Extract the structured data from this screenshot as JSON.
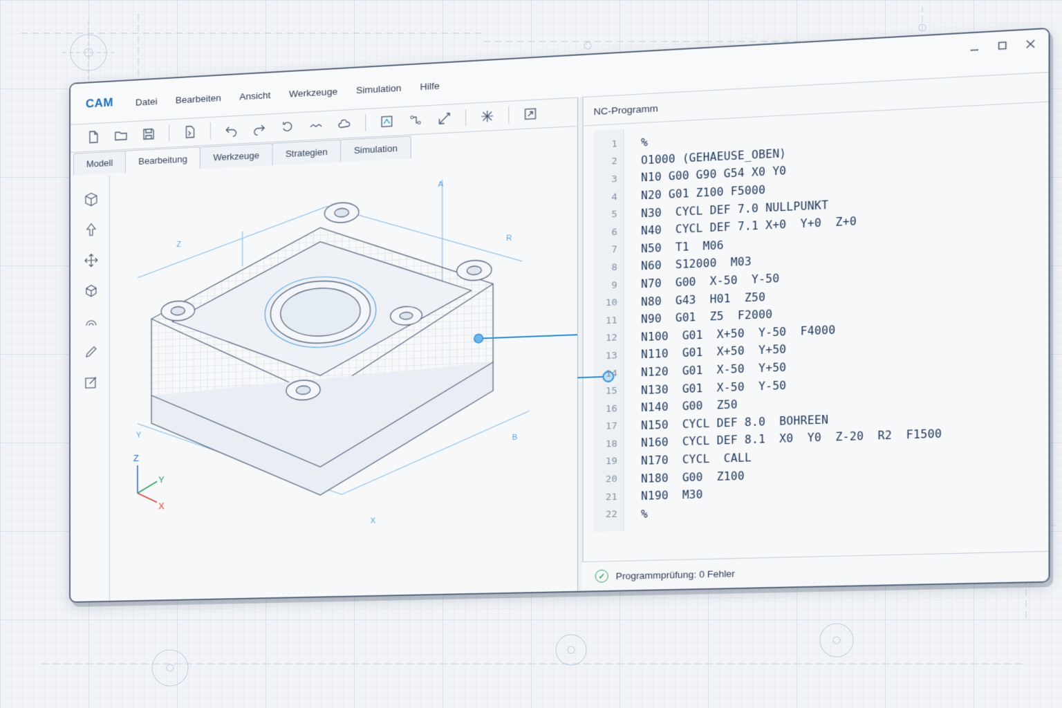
{
  "app": {
    "name": "CAM"
  },
  "menu": [
    "Datei",
    "Bearbeiten",
    "Ansicht",
    "Werkzeuge",
    "Simulation",
    "Hilfe"
  ],
  "window_controls": [
    "minimize",
    "maximize",
    "close"
  ],
  "toolbar": {
    "icons": [
      "new-file-icon",
      "open-folder-icon",
      "save-icon",
      "import-icon",
      "undo-icon",
      "redo-icon",
      "rotate-icon",
      "path-icon",
      "cloud-icon",
      "toolpath-icon",
      "nodes-icon",
      "measure-icon",
      "fixture-icon",
      "export-icon"
    ]
  },
  "tabs": [
    "Modell",
    "Bearbeitung",
    "Werkzeuge",
    "Strategien",
    "Simulation"
  ],
  "active_tab": "Bearbeitung",
  "left_tools": [
    "cube-icon",
    "arrow-select-icon",
    "move-icon",
    "box-icon",
    "arc-icon",
    "pencil-icon",
    "edit-icon"
  ],
  "viewport": {
    "axes": {
      "x": "X",
      "y": "Y",
      "z": "Z"
    },
    "dimension_labels": [
      "Z",
      "A",
      "R",
      "Y",
      "B",
      "X"
    ]
  },
  "nc_panel": {
    "title": "NC-Programm",
    "lines": [
      "%",
      "O1000 (GEHAEUSE_OBEN)",
      "N10 G00 G90 G54 X0 Y0",
      "N20 G01 Z100 F5000",
      "N30  CYCL DEF 7.0 NULLPUNKT",
      "N40  CYCL DEF 7.1 X+0  Y+0  Z+0",
      "N50  T1  M06",
      "N60  S12000  M03",
      "N70  G00  X-50  Y-50",
      "N80  G43  H01  Z50",
      "N90  G01  Z5  F2000",
      "N100  G01  X+50  Y-50  F4000",
      "N110  G01  X+50  Y+50",
      "N120  G01  X-50  Y+50",
      "N130  G01  X-50  Y-50",
      "N140  G00  Z50",
      "N150  CYCL DEF 8.0  BOHREEN",
      "N160  CYCL DEF 8.1  X0  Y0  Z-20  R2  F1500",
      "N170  CYCL  CALL",
      "N180  G00  Z100",
      "N190  M30",
      "%"
    ],
    "highlighted_line": 11
  },
  "status": {
    "text": "Programmprüfung: 0 Fehler",
    "icon": "check-circle-icon"
  },
  "colors": {
    "accent": "#1f6fb8",
    "link": "#2f8fd6",
    "ok": "#3aa66a"
  }
}
